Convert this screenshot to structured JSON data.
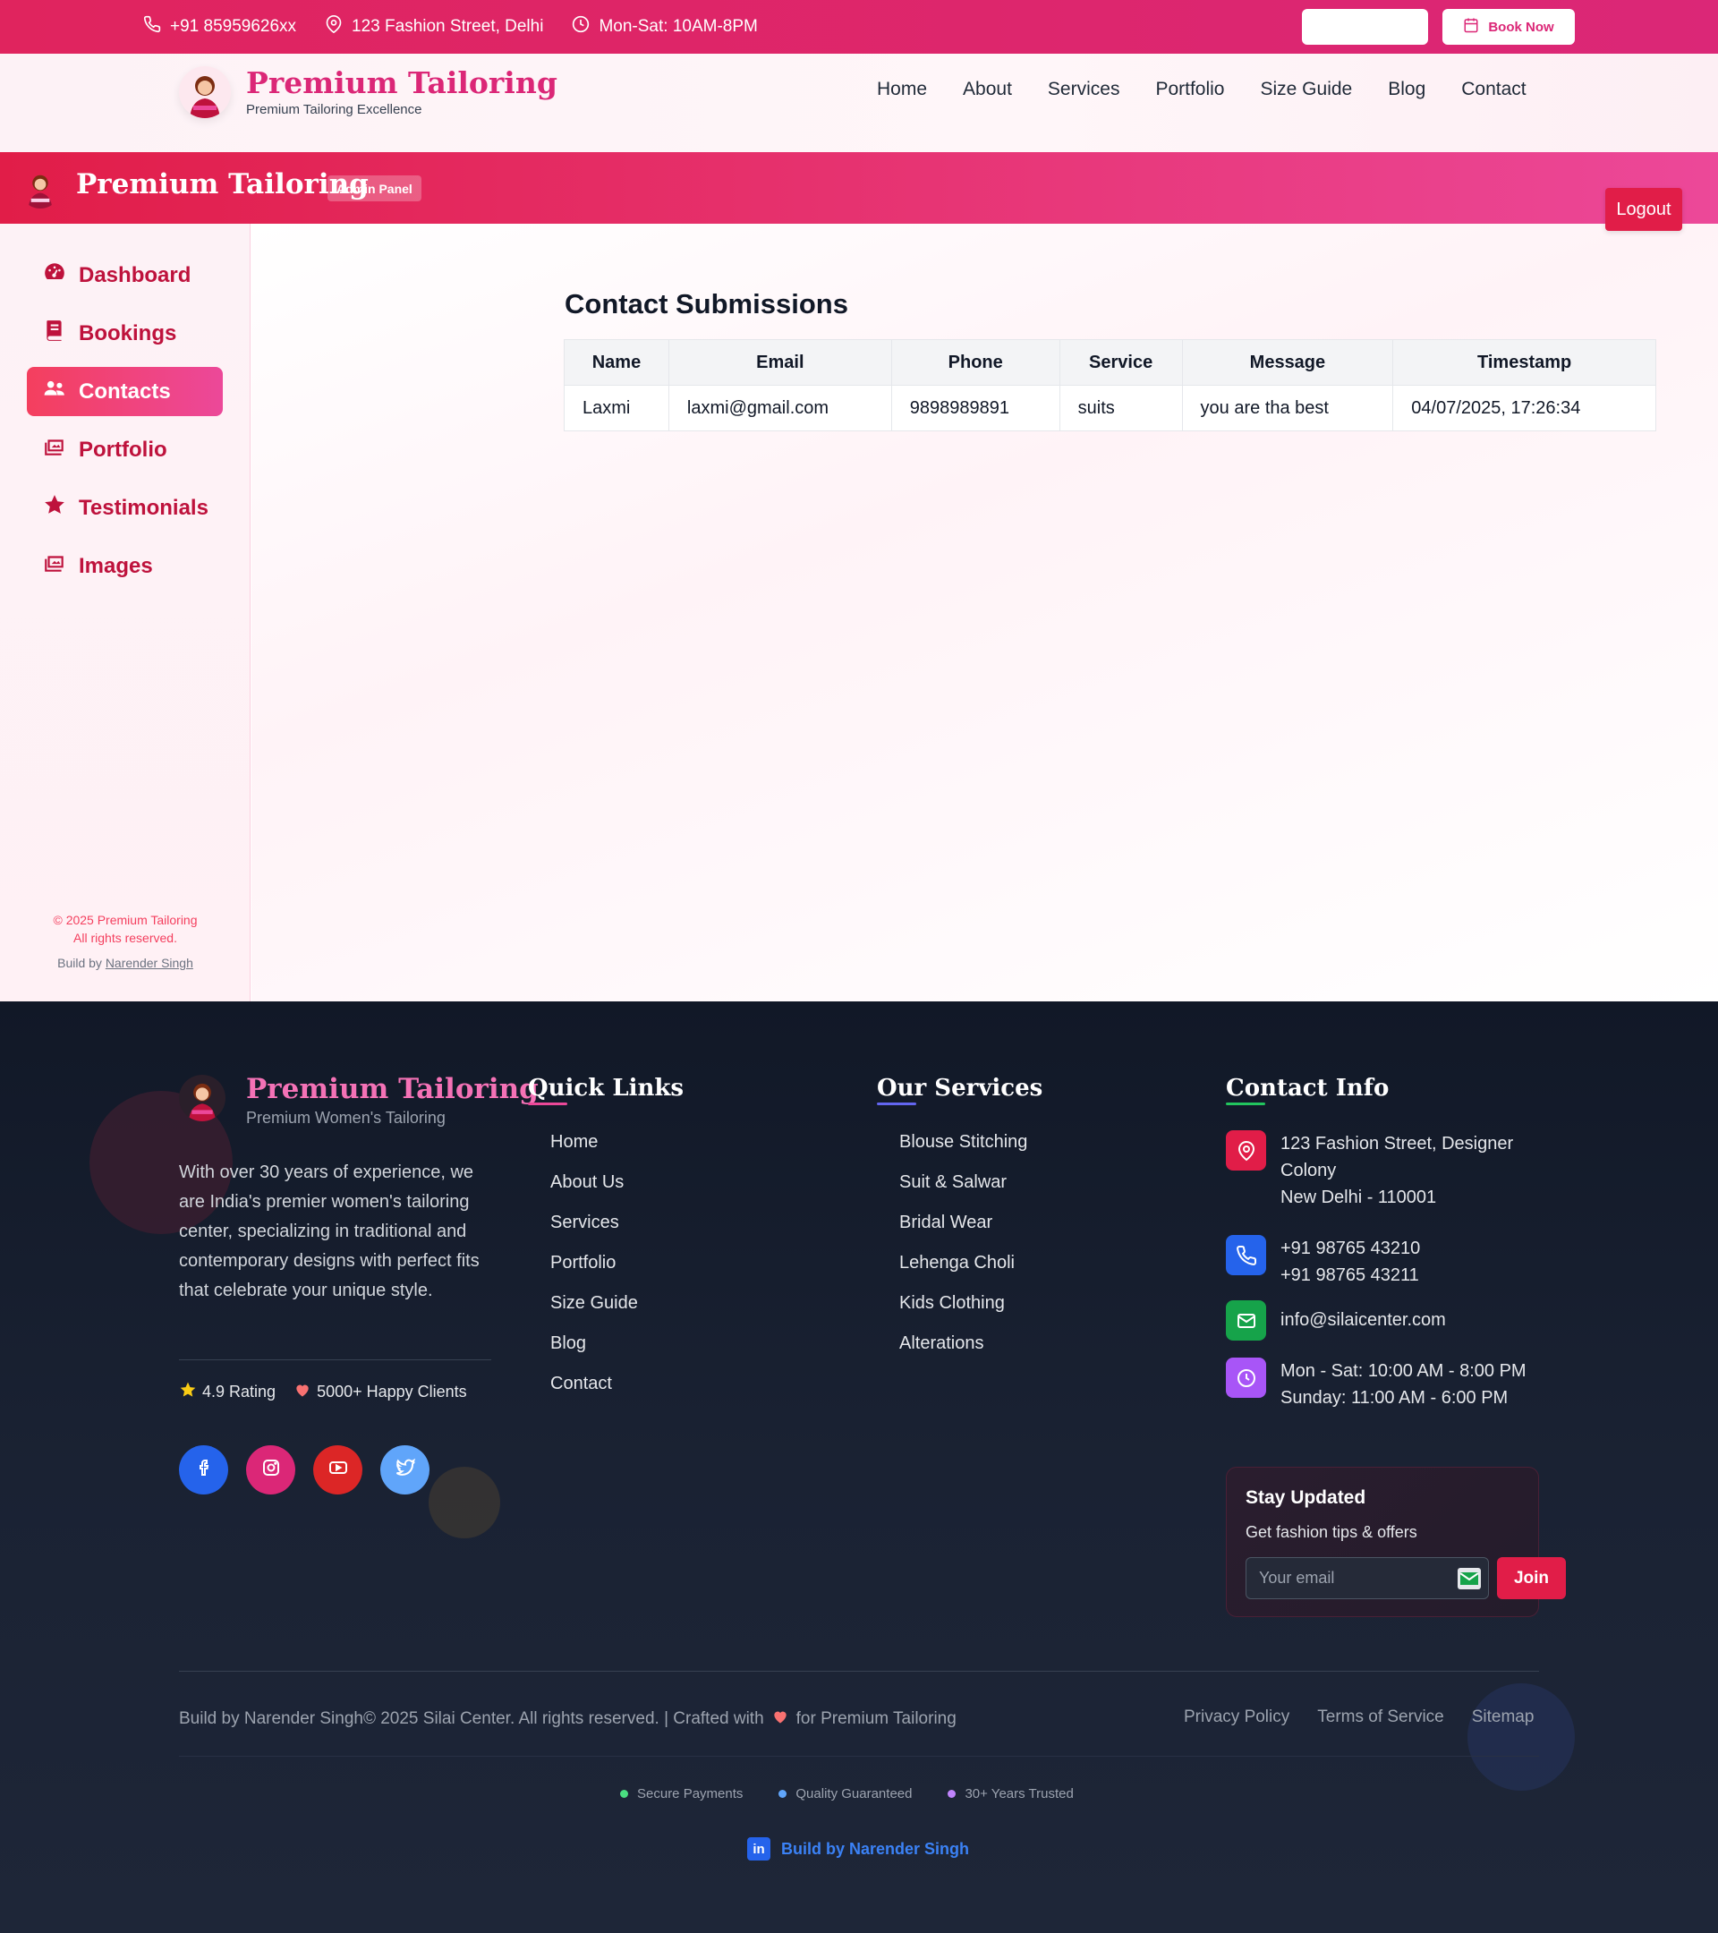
{
  "topbar": {
    "phone": "+91 85959626xx",
    "address": "123 Fashion Street, Delhi",
    "hours": "Mon-Sat: 10AM-8PM",
    "book_label": "Book Now"
  },
  "site_nav": {
    "brand": "Premium Tailoring",
    "tagline": "Premium Tailoring Excellence",
    "menu": [
      "Home",
      "About",
      "Services",
      "Portfolio",
      "Size Guide",
      "Blog",
      "Contact"
    ]
  },
  "admin_header": {
    "title": "Premium Tailoring",
    "badge": "Admin Panel",
    "logout_label": "Logout"
  },
  "sidebar": {
    "items": [
      {
        "label": "Dashboard",
        "icon": "gauge-icon"
      },
      {
        "label": "Bookings",
        "icon": "book-icon"
      },
      {
        "label": "Contacts",
        "icon": "users-icon"
      },
      {
        "label": "Portfolio",
        "icon": "images-icon"
      },
      {
        "label": "Testimonials",
        "icon": "star-icon"
      },
      {
        "label": "Images",
        "icon": "images-icon"
      }
    ],
    "active_index": 2,
    "copyright_line1": "© 2025 Premium Tailoring",
    "copyright_line2": "All rights reserved.",
    "build_prefix": "Build by",
    "build_name": "Narender Singh"
  },
  "main": {
    "title": "Contact Submissions",
    "columns": [
      "Name",
      "Email",
      "Phone",
      "Service",
      "Message",
      "Timestamp"
    ],
    "rows": [
      [
        "Laxmi",
        "laxmi@gmail.com",
        "9898989891",
        "suits",
        "you are tha best",
        "04/07/2025, 17:26:34"
      ]
    ]
  },
  "footer": {
    "brand": "Premium Tailoring",
    "tagline": "Premium Women's Tailoring",
    "about": "With over 30 years of experience, we are India's premier women's tailoring center, specializing in traditional and contemporary designs with perfect fits that celebrate your unique style.",
    "rating": "4.9 Rating",
    "clients": "5000+ Happy Clients",
    "quick_links_title": "Quick Links",
    "quick_links": [
      "Home",
      "About Us",
      "Services",
      "Portfolio",
      "Size Guide",
      "Blog",
      "Contact"
    ],
    "services_title": "Our Services",
    "services": [
      "Blouse Stitching",
      "Suit & Salwar",
      "Bridal Wear",
      "Lehenga Choli",
      "Kids Clothing",
      "Alterations"
    ],
    "contact_title": "Contact Info",
    "address_line1": "123 Fashion Street, Designer Colony",
    "address_line2": "New Delhi - 110001",
    "phone1": "+91 98765 43210",
    "phone2": "+91 98765 43211",
    "email": "info@silaicenter.com",
    "hours1": "Mon - Sat: 10:00 AM - 8:00 PM",
    "hours2": "Sunday: 11:00 AM - 6:00 PM",
    "newsletter_title": "Stay Updated",
    "newsletter_sub": "Get fashion tips & offers",
    "newsletter_placeholder": "Your email",
    "join_label": "Join",
    "bottom_left": "Build by Narender Singh© 2025 Silai Center. All rights reserved. | Crafted with",
    "bottom_left_suffix": "for Premium Tailoring",
    "legal": [
      "Privacy Policy",
      "Terms of Service",
      "Sitemap"
    ],
    "trust": [
      "Secure Payments",
      "Quality Guaranteed",
      "30+ Years Trusted"
    ],
    "credit": "Build by Narender Singh",
    "colors": {
      "pink": "#e11d48",
      "accent": "#db2777",
      "dark": "#111827"
    }
  }
}
